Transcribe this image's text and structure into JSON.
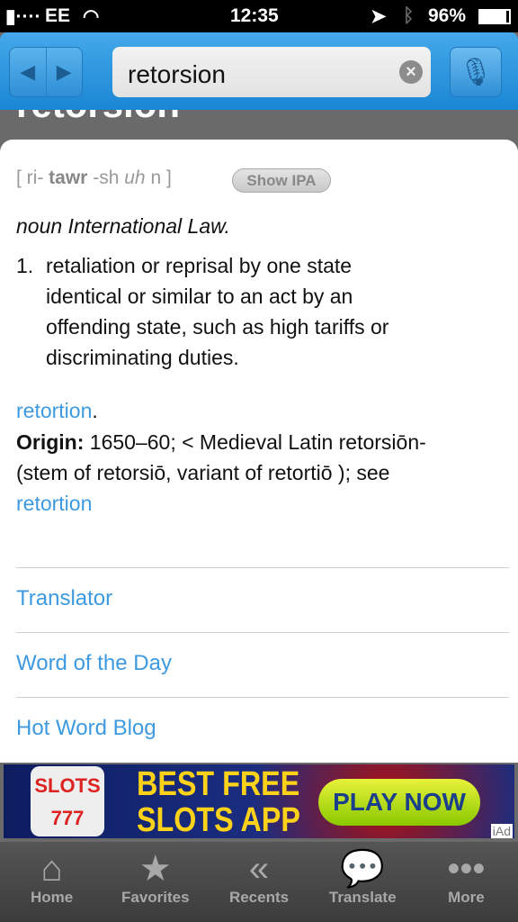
{
  "status": {
    "carrier": "EE",
    "time": "12:35",
    "battery": "96%"
  },
  "header": {
    "search_value": "retorsion",
    "back_icon": "triangle-left",
    "forward_icon": "triangle-right",
    "mic_icon": "microphone"
  },
  "entry": {
    "title": "retorsion",
    "pron": {
      "open": "[ ri-",
      "stress": "tawr",
      "mid": "-sh",
      "ital": "uh",
      "end": " n ]",
      "show_ipa": "Show IPA"
    },
    "pos": "noun International Law.",
    "def_num": "1.",
    "def_lines": [
      "retaliation or reprisal by one state",
      "identical or similar to an act by an",
      "offending state, such as high tariffs or",
      "discriminating duties."
    ],
    "see_link": "retortion",
    "origin_label": "Origin:",
    "origin_line1": " 1650–60;  < Medieval Latin retorsiōn-",
    "origin_line2": " (stem of retorsiō,  variant of retortiō ); see",
    "origin_link": "retortion"
  },
  "links": [
    "Translator",
    "Word of the Day",
    "Hot Word Blog"
  ],
  "ad": {
    "left": "SLOTS 777",
    "headline1": "BEST FREE",
    "headline2": "SLOTS APP",
    "cta": "PLAY NOW",
    "badge": "iAd"
  },
  "tabs": [
    {
      "label": "Home",
      "icon": "home"
    },
    {
      "label": "Favorites",
      "icon": "star"
    },
    {
      "label": "Recents",
      "icon": "reply-all"
    },
    {
      "label": "Translate",
      "icon": "speech-bubbles"
    },
    {
      "label": "More",
      "icon": "ellipsis"
    }
  ],
  "colors": {
    "header": "#2a95e0",
    "link": "#3d9ae0",
    "tabbar": "#444444"
  }
}
